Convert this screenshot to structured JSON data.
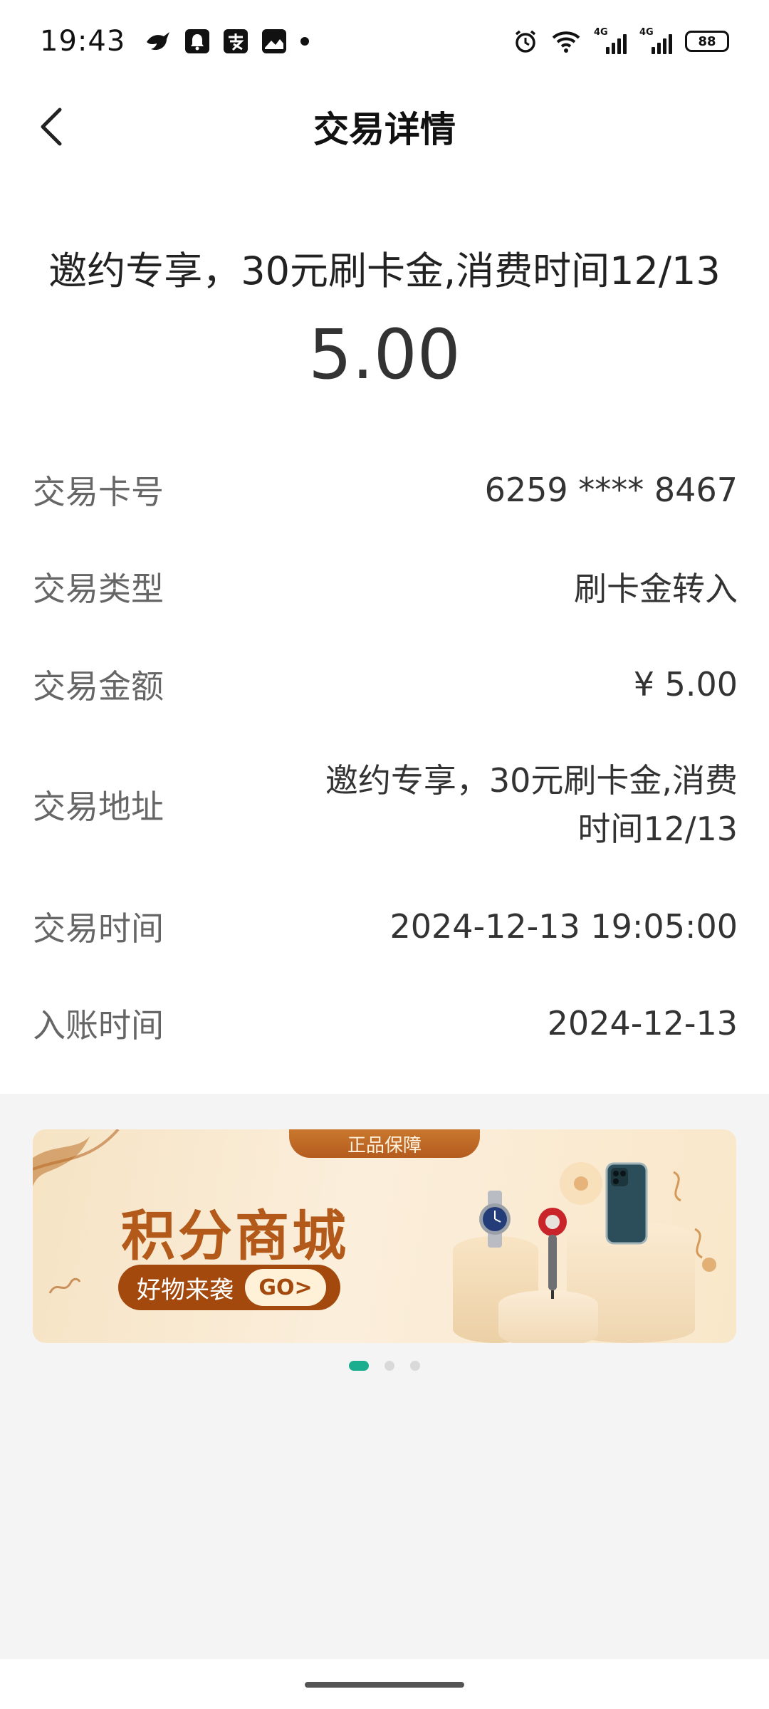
{
  "status_bar": {
    "time": "19:43",
    "app_icons": [
      "bird-app-icon",
      "bell-app-icon",
      "alipay-app-icon",
      "photo-app-icon"
    ],
    "signal_labels": [
      "4G",
      "4G"
    ],
    "battery": "88"
  },
  "header": {
    "title": "交易详情"
  },
  "summary": {
    "description": "邀约专享，30元刷卡金,消费时间12/13",
    "amount": "5.00"
  },
  "details": [
    {
      "label": "交易卡号",
      "value": "6259 **** 8467"
    },
    {
      "label": "交易类型",
      "value": "刷卡金转入"
    },
    {
      "label": "交易金额",
      "value": "¥ 5.00"
    },
    {
      "label": "交易地址",
      "value": "邀约专享，30元刷卡金,消费时间12/13"
    },
    {
      "label": "交易时间",
      "value": "2024-12-13 19:05:00"
    },
    {
      "label": "入账时间",
      "value": "2024-12-13"
    }
  ],
  "banner": {
    "tag": "正品保障",
    "title": "积分商城",
    "cta_text": "好物来袭",
    "cta_button": "GO>",
    "accent_color": "#a3490e"
  },
  "carousel": {
    "pages": 3,
    "active_index": 0,
    "active_color": "#1aae8f"
  }
}
